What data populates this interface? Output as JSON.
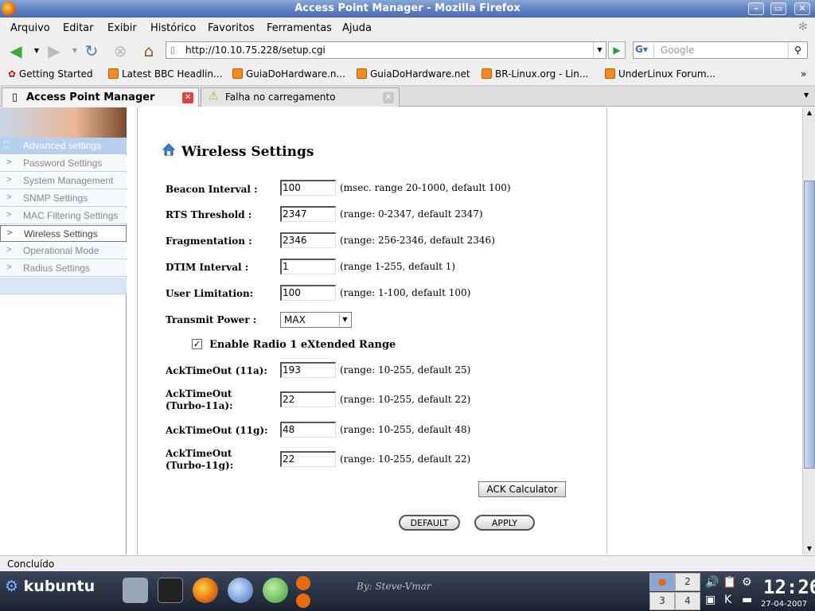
{
  "window": {
    "title": "Access Point Manager - Mozilla Firefox"
  },
  "menu": [
    "Arquivo",
    "Editar",
    "Exibir",
    "Histórico",
    "Favoritos",
    "Ferramentas",
    "Ajuda"
  ],
  "nav": {
    "url": "http://10.10.75.228/setup.cgi",
    "search_placeholder": "Google"
  },
  "bookmarks": [
    "Getting Started",
    "Latest BBC Headlin...",
    "GuiaDoHardware.n...",
    "GuiaDoHardware.net",
    "BR-Linux.org - Lin...",
    "UnderLinux Forum..."
  ],
  "tabs": [
    {
      "label": "Access Point Manager",
      "active": true
    },
    {
      "label": "Falha no carregamento",
      "active": false
    }
  ],
  "sidebar": {
    "items": [
      {
        "label": "Advanced settings",
        "kind": "header"
      },
      {
        "label": "Password Settings"
      },
      {
        "label": "System Management"
      },
      {
        "label": "SNMP Settings"
      },
      {
        "label": "MAC Filtering Settings"
      },
      {
        "label": "Wireless Settings",
        "selected": true
      },
      {
        "label": "Operational Mode"
      },
      {
        "label": "Radius Settings"
      },
      {
        "label": "",
        "kind": "blank"
      }
    ]
  },
  "form": {
    "title": "Wireless Settings",
    "fields": [
      {
        "label": "Beacon Interval :",
        "value": "100",
        "hint": "(msec. range 20-1000, default 100)"
      },
      {
        "label": "RTS Threshold :",
        "value": "2347",
        "hint": "(range: 0-2347, default 2347)"
      },
      {
        "label": "Fragmentation :",
        "value": "2346",
        "hint": "(range: 256-2346, default 2346)"
      },
      {
        "label": "DTIM Interval :",
        "value": "1",
        "hint": "(range 1-255, default 1)"
      },
      {
        "label": "User Limitation:",
        "value": "100",
        "hint": "(range: 1-100, default 100)"
      }
    ],
    "transmit_power": {
      "label": "Transmit Power :",
      "value": "MAX"
    },
    "xr": {
      "label": "Enable Radio 1 eXtended Range",
      "checked": true,
      "mark": "✓"
    },
    "ack_fields": [
      {
        "label": "AckTimeOut (11a):",
        "value": "193",
        "hint": "(range: 10-255, default 25)"
      },
      {
        "label_line1": "AckTimeOut",
        "label_line2": "(Turbo-11a):",
        "value": "22",
        "hint": "(range: 10-255, default 22)"
      },
      {
        "label": "AckTimeOut (11g):",
        "value": "48",
        "hint": "(range: 10-255, default 48)"
      },
      {
        "label_line1": "AckTimeOut",
        "label_line2": "(Turbo-11g):",
        "value": "22",
        "hint": "(range: 10-255, default 22)"
      }
    ],
    "buttons": {
      "ack_calc": "ACK Calculator",
      "default": "DEFAULT",
      "apply": "APPLY"
    }
  },
  "status": {
    "text": "Concluído"
  },
  "taskbar": {
    "start": "kubuntu",
    "desktops": [
      "2",
      "3",
      "4"
    ],
    "clock": "12:26",
    "date": "27-04-2007",
    "signature": "By: Steve-Vmar"
  }
}
